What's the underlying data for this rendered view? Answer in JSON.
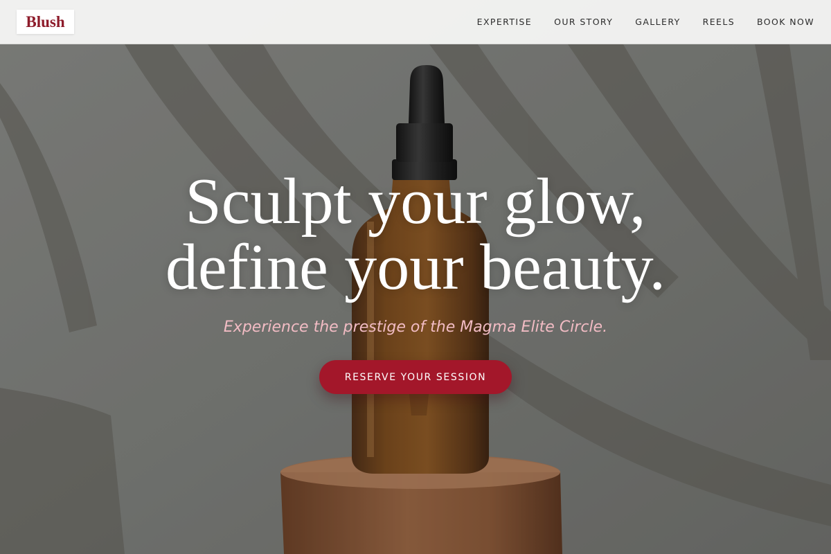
{
  "nav": {
    "brand": "Blush",
    "links": [
      {
        "label": "EXPERTISE"
      },
      {
        "label": "OUR STORY"
      },
      {
        "label": "GALLERY"
      },
      {
        "label": "REELS"
      },
      {
        "label": "BOOK NOW"
      }
    ]
  },
  "hero": {
    "headline_line1": "Sculpt your glow,",
    "headline_line2": "define your beauty.",
    "subtitle": "Experience the prestige of the Magma Elite Circle.",
    "cta_label": "RESERVE YOUR SESSION"
  },
  "colors": {
    "brand": "#8e1c2b",
    "cta_background": "#a3172a",
    "subtitle": "#f2bcc4",
    "navbar": "#f4f4f3"
  }
}
